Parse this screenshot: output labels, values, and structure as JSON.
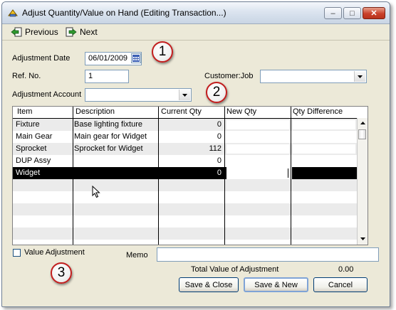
{
  "window": {
    "title": "Adjust Quantity/Value on Hand (Editing Transaction...)",
    "minimize_glyph": "–",
    "maximize_glyph": "□",
    "close_glyph": "✕"
  },
  "toolbar": {
    "previous_label": "Previous",
    "next_label": "Next"
  },
  "form": {
    "adjustment_date_label": "Adjustment Date",
    "adjustment_date_value": "06/01/2009",
    "ref_no_label": "Ref. No.",
    "ref_no_value": "1",
    "customer_job_label": "Customer:Job",
    "customer_job_value": "",
    "adjustment_account_label": "Adjustment Account",
    "adjustment_account_value": ""
  },
  "annotations": {
    "one": "1",
    "two": "2",
    "three": "3"
  },
  "grid": {
    "columns": [
      "Item",
      "Description",
      "Current Qty",
      "New Qty",
      "Qty Difference"
    ],
    "rows": [
      {
        "item": "Fixture",
        "description": "Base lighting fixture",
        "current_qty": "0",
        "new_qty": "",
        "qty_difference": ""
      },
      {
        "item": "Main Gear",
        "description": "Main gear for Widget",
        "current_qty": "0",
        "new_qty": "",
        "qty_difference": ""
      },
      {
        "item": "Sprocket",
        "description": "Sprocket for Widget",
        "current_qty": "112",
        "new_qty": "",
        "qty_difference": ""
      },
      {
        "item": "DUP Assy",
        "description": "",
        "current_qty": "0",
        "new_qty": "",
        "qty_difference": ""
      },
      {
        "item": "Widget",
        "description": "",
        "current_qty": "0",
        "new_qty": "",
        "qty_difference": ""
      }
    ],
    "selected_row": 4
  },
  "footer": {
    "value_adjustment_label": "Value Adjustment",
    "value_adjustment_checked": false,
    "memo_label": "Memo",
    "memo_value": "",
    "total_label": "Total Value of Adjustment",
    "total_value": "0.00"
  },
  "buttons": {
    "save_close": "Save & Close",
    "save_new": "Save & New",
    "cancel": "Cancel"
  },
  "colors": {
    "title_gradient_top": "#f4f7fb",
    "close_button": "#c9402a",
    "selected_row": "#000000",
    "badge_border": "#c21d1d",
    "dialog_background": "#ece9d8"
  },
  "icons": [
    "app-icon",
    "previous-icon",
    "next-icon",
    "calendar-icon",
    "dropdown-arrow-icon",
    "scroll-up-icon",
    "scroll-down-icon",
    "mouse-cursor-icon",
    "checkbox-icon"
  ]
}
